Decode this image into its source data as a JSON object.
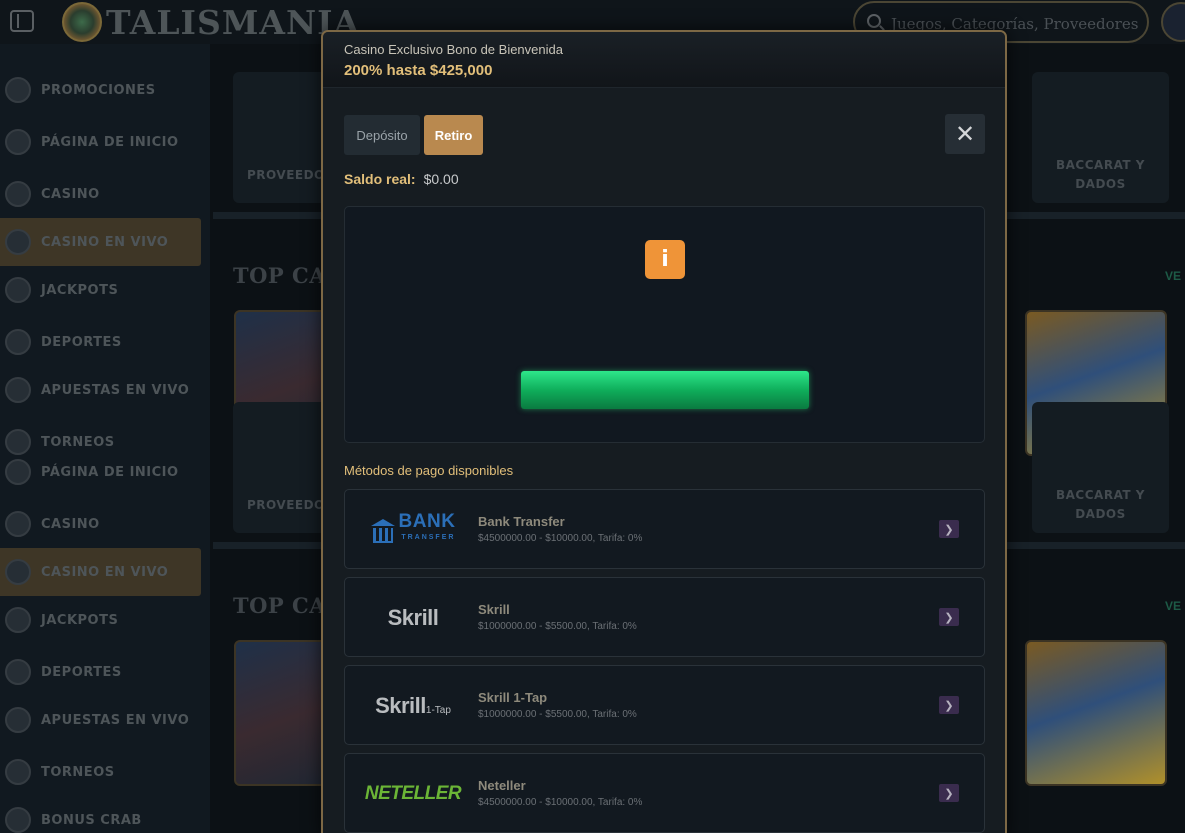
{
  "header": {
    "brand": "TALISMANIA",
    "search_placeholder": "Juegos, Categorías, Proveedores"
  },
  "sidebar": {
    "items": [
      {
        "label": "PROMOCIONES",
        "active": false
      },
      {
        "label": "PÁGINA DE INICIO",
        "active": false
      },
      {
        "label": "CASINO",
        "active": false
      },
      {
        "label": "CASINO EN VIVO",
        "active": true
      },
      {
        "label": "JACKPOTS",
        "active": false
      },
      {
        "label": "DEPORTES",
        "active": false
      },
      {
        "label": "APUESTAS EN VIVO",
        "active": false
      },
      {
        "label": "TORNEOS",
        "active": false
      },
      {
        "label": "PÁGINA DE INICIO",
        "active": false
      },
      {
        "label": "CASINO",
        "active": false
      },
      {
        "label": "CASINO EN VIVO",
        "active": true
      },
      {
        "label": "JACKPOTS",
        "active": false
      },
      {
        "label": "DEPORTES",
        "active": false
      },
      {
        "label": "APUESTAS EN VIVO",
        "active": false
      },
      {
        "label": "TORNEOS",
        "active": false
      },
      {
        "label": "BONUS CRAB",
        "active": false
      }
    ]
  },
  "background": {
    "category_left": "PROVEEDO",
    "category_right_line1": "BACCARAT Y",
    "category_right_line2": "DADOS",
    "section_title": "TOP CA",
    "see_more": "VE"
  },
  "modal": {
    "title": "Casino Exclusivo Bono de Bienvenida",
    "subtitle": "200% hasta $425,000",
    "tabs": {
      "deposit": "Depósito",
      "withdraw": "Retiro"
    },
    "close_symbol": "✕",
    "balance_label": "Saldo real:",
    "balance_value": "$0.00",
    "info_symbol": "i",
    "methods_title": "Métodos de pago disponibles",
    "methods": [
      {
        "name": "Bank Transfer",
        "details": "$4500000.00 - $10000.00, Tarifa: 0%",
        "logo": "bank-transfer-logo",
        "logo_text": "BANK",
        "logo_sub": "TRANSFER"
      },
      {
        "name": "Skrill",
        "details": "$1000000.00 - $5500.00, Tarifa: 0%",
        "logo": "skrill-logo",
        "logo_text": "Skrill",
        "logo_sub": ""
      },
      {
        "name": "Skrill 1-Tap",
        "details": "$1000000.00 - $5500.00, Tarifa: 0%",
        "logo": "skrill-1tap-logo",
        "logo_text": "Skrill",
        "logo_sub": "1-Tap"
      },
      {
        "name": "Neteller",
        "details": "$4500000.00 - $10000.00, Tarifa: 0%",
        "logo": "neteller-logo",
        "logo_text": "NETELLER",
        "logo_sub": ""
      }
    ],
    "arrow_symbol": "❯"
  },
  "colors": {
    "accent_gold": "#e2bf7a",
    "tab_active": "#b9894f",
    "info_orange": "#ef9438",
    "action_green": "#12c56a"
  }
}
